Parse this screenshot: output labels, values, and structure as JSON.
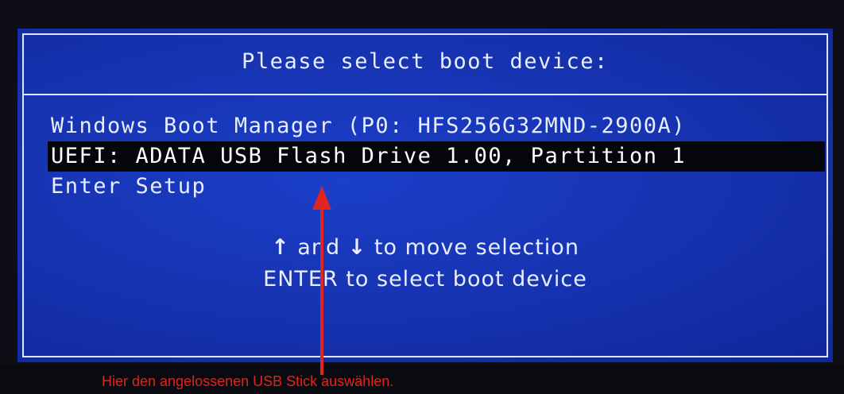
{
  "boot_menu": {
    "title": "Please select boot device:",
    "items": [
      {
        "label": "Windows Boot Manager (P0: HFS256G32MND-2900A)",
        "selected": false
      },
      {
        "label": "UEFI: ADATA USB Flash Drive 1.00, Partition 1",
        "selected": true
      },
      {
        "label": "Enter Setup",
        "selected": false
      }
    ],
    "hints": {
      "up_arrow": "↑",
      "and": "and",
      "down_arrow": "↓",
      "move": "to move selection",
      "enter_line": "ENTER to select boot device"
    }
  },
  "annotation": {
    "text": "Hier den angelossenen USB Stick auswählen.",
    "color": "#e0241f"
  },
  "colors": {
    "bios_blue": "#1734b3",
    "bios_text": "#e8edff",
    "selection_bg": "#05060a"
  }
}
